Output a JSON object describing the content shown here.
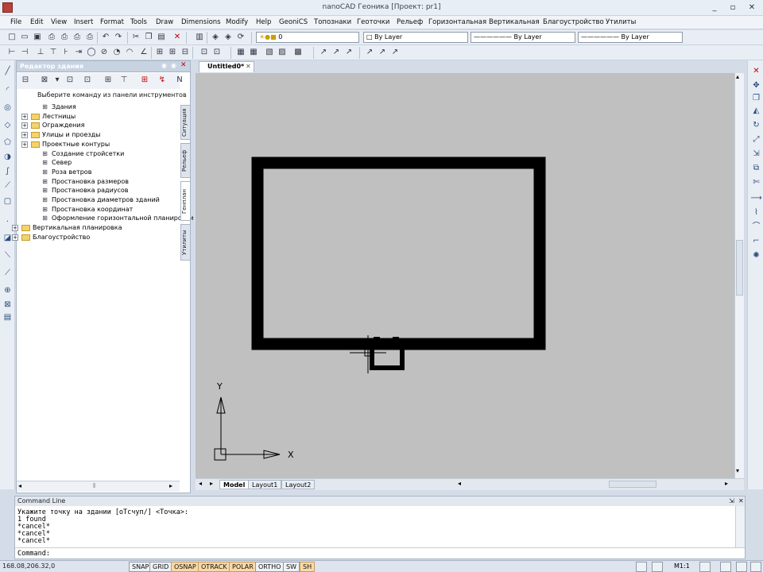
{
  "window": {
    "title": "nanoCAD Геоника [Проект: pr1]",
    "minimize": "_",
    "maximize": "▫",
    "close": "✕"
  },
  "menu": [
    "File",
    "Edit",
    "View",
    "Insert",
    "Format",
    "Tools",
    "Draw",
    "Dimensions",
    "Modify",
    "Help",
    "GeoniCS",
    "Топознаки",
    "Геоточки",
    "Рельеф",
    "Горизонтальная",
    "Вертикальная",
    "Благоустройство",
    "Утилиты"
  ],
  "toolbar": {
    "layer_combo": "0",
    "color_combo": "By Layer",
    "linetype_combo": "By Layer",
    "lineweight_combo": "By Layer"
  },
  "panel": {
    "title": "Редактор здания",
    "hint": "Выберите команду из панели инструментов",
    "tree": [
      {
        "label": "Здания",
        "indent": 2,
        "kind": "tool"
      },
      {
        "label": "Лестницы",
        "indent": 1,
        "kind": "folder"
      },
      {
        "label": "Ограждения",
        "indent": 1,
        "kind": "folder"
      },
      {
        "label": "Улицы и проезды",
        "indent": 1,
        "kind": "folder"
      },
      {
        "label": "Проектные контуры",
        "indent": 1,
        "kind": "folder"
      },
      {
        "label": "Создание стройсетки",
        "indent": 2,
        "kind": "tool"
      },
      {
        "label": "Север",
        "indent": 2,
        "kind": "tool"
      },
      {
        "label": "Роза ветров",
        "indent": 2,
        "kind": "tool"
      },
      {
        "label": "Простановка размеров",
        "indent": 2,
        "kind": "tool"
      },
      {
        "label": "Простановка радиусов",
        "indent": 2,
        "kind": "tool"
      },
      {
        "label": "Простановка диаметров зданий",
        "indent": 2,
        "kind": "tool"
      },
      {
        "label": "Простановка координат",
        "indent": 2,
        "kind": "tool"
      },
      {
        "label": "Оформление горизонтальной планировки",
        "indent": 2,
        "kind": "tool"
      },
      {
        "label": "Вертикальная планировка",
        "indent": 0,
        "kind": "folder"
      },
      {
        "label": "Благоустройство",
        "indent": 0,
        "kind": "folder"
      }
    ],
    "side_tabs": [
      "Ситуация",
      "Рельеф",
      "Генплан",
      "Утилиты"
    ]
  },
  "document": {
    "tab": "Untitled0*",
    "layouts": [
      "Model",
      "Layout1",
      "Layout2"
    ],
    "ucs_x": "X",
    "ucs_y": "Y"
  },
  "command": {
    "header": "Command Line",
    "lines": [
      "Укажите точку на здании [оТсчуп/] <Точка>:",
      "1 found",
      "*cancel*",
      "*cancel*",
      "*cancel*"
    ],
    "prompt": "Command:"
  },
  "status": {
    "coords": "168.08,206.32,0",
    "buttons": [
      {
        "label": "SNAP",
        "on": false
      },
      {
        "label": "GRID",
        "on": false
      },
      {
        "label": "OSNAP",
        "on": true
      },
      {
        "label": "OTRACK",
        "on": true
      },
      {
        "label": "POLAR",
        "on": true
      },
      {
        "label": "ORTHO",
        "on": false
      },
      {
        "label": "SW",
        "on": false
      },
      {
        "label": "SH",
        "on": true
      }
    ],
    "scale": "M1:1"
  },
  "colors": {
    "canvas": "#c0c0c0",
    "drawing": "#000000",
    "active_toggle": "#f8d9a8"
  }
}
